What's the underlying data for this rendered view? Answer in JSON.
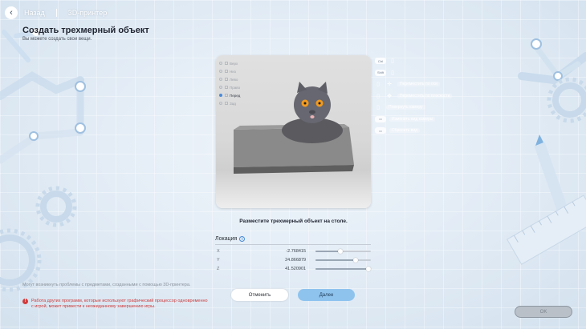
{
  "topbar": {
    "back_label": "Назад",
    "section": "3D-принтер"
  },
  "page": {
    "title": "Создать трехмерный объект",
    "subtitle": "Вы можете создать свои вещи."
  },
  "views": [
    {
      "label": "Верх",
      "active": false
    },
    {
      "label": "Низ",
      "active": false
    },
    {
      "label": "Левo",
      "active": false
    },
    {
      "label": "Право",
      "active": false
    },
    {
      "label": "Перед",
      "active": true
    },
    {
      "label": "Зад",
      "active": false
    }
  ],
  "hints": [
    {
      "key": "Ctrl",
      "text": ""
    },
    {
      "key": "Shift",
      "text": ""
    },
    {
      "key": "",
      "text": "Переместить по оси"
    },
    {
      "key": "",
      "text": "Переместить по плоскости"
    },
    {
      "key": "",
      "text": "Повернуть камеру"
    },
    {
      "key": "",
      "text": "Изменить вид камеры"
    },
    {
      "key": "",
      "text": "Сбросить вид"
    }
  ],
  "placement_text": "Разместите трехмерный объект на столе.",
  "location": {
    "title": "Локация",
    "rows": [
      {
        "axis": "X",
        "value": "-2.768415",
        "level": 0.45
      },
      {
        "axis": "Y",
        "value": "24.866879",
        "level": 0.72
      },
      {
        "axis": "Z",
        "value": "41.520901",
        "level": 0.96
      }
    ]
  },
  "warnings": {
    "info": "Могут возникнуть проблемы с предметами, созданными с помощью 3D-принтера.",
    "alert": "Работа других программ, которые используют графический процессор одновременно с игрой, может привести к неожиданному завершению игры."
  },
  "buttons": {
    "cancel": "Отменить",
    "next": "Далее",
    "ok": "OK"
  },
  "colors": {
    "accent": "#8ec3ee",
    "alert": "#cc3b3b",
    "cat_eyes": "#f29a1e"
  }
}
